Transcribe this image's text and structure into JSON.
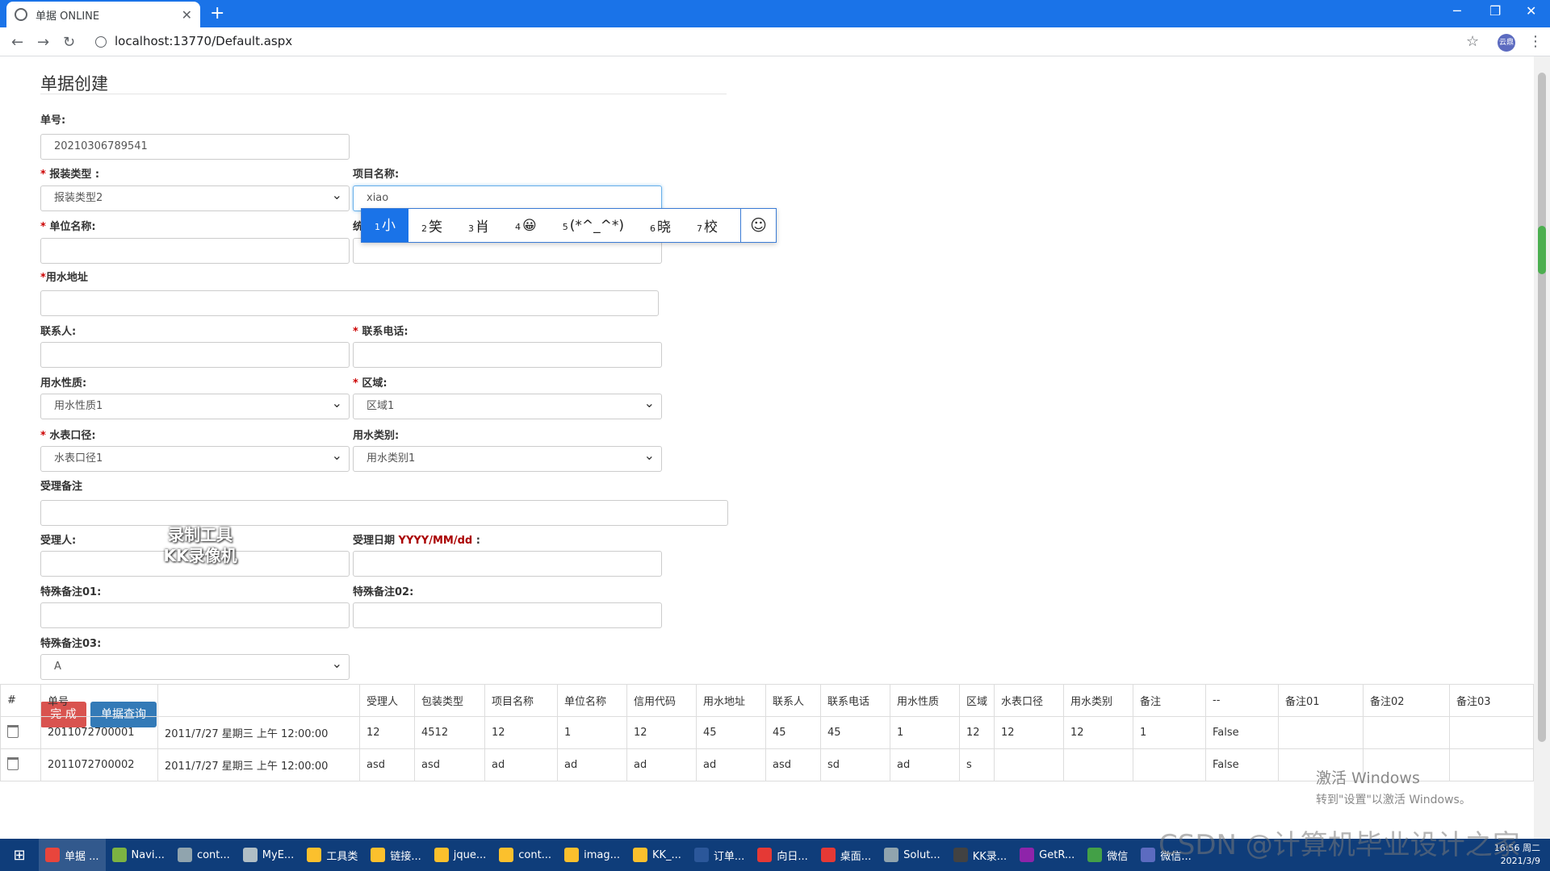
{
  "browser": {
    "tab_title": "单据 ONLINE",
    "url": "localhost:13770/Default.aspx",
    "profile": "云鼎"
  },
  "page": {
    "title": "单据创建"
  },
  "form": {
    "order_no_label": "单号:",
    "order_no_value": "20210306789541",
    "pkg_type_label": "报装类型 :",
    "pkg_type_value": "报装类型2",
    "project_label": "项目名称:",
    "project_value": "xiao",
    "unit_label": "单位名称:",
    "credit_label_partial": "统",
    "address_label": "用水地址",
    "contact_label": "联系人:",
    "phone_label": "联系电话:",
    "water_nature_label": "用水性质:",
    "water_nature_value": "用水性质1",
    "region_label": "区域:",
    "region_value": "区域1",
    "meter_label": "水表口径:",
    "meter_value": "水表口径1",
    "water_cat_label": "用水类别:",
    "water_cat_value": "用水类别1",
    "accept_note_label": "受理备注",
    "acceptor_label": "受理人:",
    "accept_date_label": "受理日期",
    "accept_date_format": "YYYY/MM/dd",
    "accept_date_colon": ":",
    "special01_label": "特殊备注01:",
    "special02_label": "特殊备注02:",
    "special03_label": "特殊备注03:",
    "special03_value": "A",
    "submit_label": "完 成",
    "query_label": "单据查询"
  },
  "ime": {
    "candidates": [
      {
        "num": "1",
        "text": "小"
      },
      {
        "num": "2",
        "text": "笑"
      },
      {
        "num": "3",
        "text": "肖"
      },
      {
        "num": "4",
        "text": "😀"
      },
      {
        "num": "5",
        "text": "(*^_^*)"
      },
      {
        "num": "6",
        "text": "晓"
      },
      {
        "num": "7",
        "text": "校"
      }
    ],
    "emoji_button": "☺"
  },
  "watermark": {
    "line1": "录制工具",
    "line2": "KK录像机"
  },
  "table": {
    "headers": [
      "#",
      "单号",
      "",
      "受理人",
      "包装类型",
      "项目名称",
      "单位名称",
      "信用代码",
      "用水地址",
      "联系人",
      "联系电话",
      "用水性质",
      "区域",
      "水表口径",
      "用水类别",
      "备注",
      "--",
      "备注01",
      "备注02",
      "备注03"
    ],
    "rows": [
      [
        "2011072700001",
        "2011/7/27 星期三 上午 12:00:00",
        "12",
        "4512",
        "12",
        "1",
        "12",
        "45",
        "45",
        "45",
        "1",
        "12",
        "12",
        "12",
        "1",
        "False",
        "",
        "",
        ""
      ],
      [
        "2011072700002",
        "2011/7/27 星期三 上午 12:00:00",
        "asd",
        "asd",
        "ad",
        "ad",
        "ad",
        "ad",
        "asd",
        "sd",
        "ad",
        "s",
        "",
        "",
        "",
        "False",
        "",
        "",
        ""
      ]
    ]
  },
  "overlay": {
    "activate_line1": "激活 Windows",
    "activate_line2": "转到\"设置\"以激活 Windows。",
    "csdn": "CSDN @计算机毕业设计之家"
  },
  "taskbar": {
    "items": [
      {
        "label": "单据 ...",
        "color": "#e8453c"
      },
      {
        "label": "Navi...",
        "color": "#7cb342"
      },
      {
        "label": "cont...",
        "color": "#90a4ae"
      },
      {
        "label": "MyE...",
        "color": "#b0bec5"
      },
      {
        "label": "工具类",
        "color": "#fbc02d"
      },
      {
        "label": "链接...",
        "color": "#fbc02d"
      },
      {
        "label": "jque...",
        "color": "#fbc02d"
      },
      {
        "label": "cont...",
        "color": "#fbc02d"
      },
      {
        "label": "imag...",
        "color": "#fbc02d"
      },
      {
        "label": "KK_...",
        "color": "#fbc02d"
      },
      {
        "label": "订单...",
        "color": "#2b579a"
      },
      {
        "label": "向日...",
        "color": "#e53935"
      },
      {
        "label": "桌面...",
        "color": "#e53935"
      },
      {
        "label": "Solut...",
        "color": "#90a4ae"
      },
      {
        "label": "KK录...",
        "color": "#424242"
      },
      {
        "label": "GetR...",
        "color": "#8e24aa"
      },
      {
        "label": "微信",
        "color": "#43a047"
      },
      {
        "label": "微信...",
        "color": "#5c6bc0"
      }
    ],
    "time": "16:56 周二",
    "date": "2021/3/9"
  }
}
